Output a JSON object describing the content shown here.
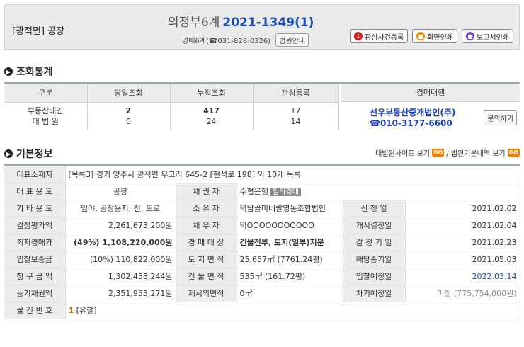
{
  "header": {
    "tag": "[광적면] 공장",
    "court": "의정부6계",
    "case_no": "2021-1349(1)",
    "sub_text": "경매6계(",
    "phone": "031-828-0326)",
    "court_info_btn": "법원안내",
    "buttons": [
      "관심사건등록",
      "화면인쇄",
      "보고서인쇄"
    ]
  },
  "stats_section": {
    "title": "조회통계",
    "columns": [
      "구분",
      "당일조회",
      "누적조회",
      "관심등록"
    ],
    "rows": [
      {
        "label": "부동산태인",
        "today": "2",
        "total": "417",
        "interest": "17"
      },
      {
        "label": "대 법 원",
        "today": "0",
        "total": "24",
        "interest": "14"
      }
    ],
    "agent_header": "경매대행",
    "agent_name": "선우부동산중개법인(주)",
    "agent_phone": "☎010-3177-6600",
    "inquiry_btn": "문의하기"
  },
  "basic_section": {
    "title": "기본정보",
    "link1": "대법원사이트 보기",
    "link2": "/ 법원기본내역 보기",
    "go": "GO",
    "address_label": "대표소재지",
    "address": "[목록3] 경기 양주시 광적면 우고리 645-2 [현석로 198] 외 10개 목록",
    "rows": [
      {
        "l1": "대 표 용 도",
        "v1": "공장",
        "l2": "채 권 자",
        "v2": "수협은행",
        "badge": "임의경매",
        "l3": "",
        "v3": ""
      },
      {
        "l1": "기 타 용 도",
        "v1": "임야, 공장용지, 전, 도로",
        "l2": "소 유 자",
        "v2": "덕담골미네랄영농조합법인",
        "l3": "신 청 일",
        "v3": "2021.02.02"
      },
      {
        "l1": "감정평가액",
        "v1": "2,261,673,200원",
        "l2": "채 무 자",
        "v2": "덕OOOOOOOOOOO",
        "l3": "개시결정일",
        "v3": "2021.02.04"
      },
      {
        "l1": "최저경매가",
        "v1": "(49%) 1,108,220,000원",
        "l2": "경 매 대 상",
        "v2": "건물전부, 토지(일부)지분",
        "l3": "감 정 기 일",
        "v3": "2021.02.23"
      },
      {
        "l1": "입찰보증금",
        "v1": "(10%) 110,822,000원",
        "l2": "토 지 면 적",
        "v2": "25,657㎡ (7761.24평)",
        "l3": "배당종기일",
        "v3": "2021.05.03"
      },
      {
        "l1": "청 구 금 액",
        "v1": "1,302,458,244원",
        "l2": "건 물 면 적",
        "v2": "535㎡ (161.72평)",
        "l3": "입찰예정일",
        "v3": "2022.03.14"
      },
      {
        "l1": "등기채권액",
        "v1": "2,351,955,271원",
        "l2": "제시외면적",
        "v2": "0㎡",
        "l3": "차기예정일",
        "v3": "미정 (775,754,000원)"
      }
    ],
    "last_label": "물 건 번 호",
    "last_num": "1",
    "last_status": "[유찰]"
  }
}
